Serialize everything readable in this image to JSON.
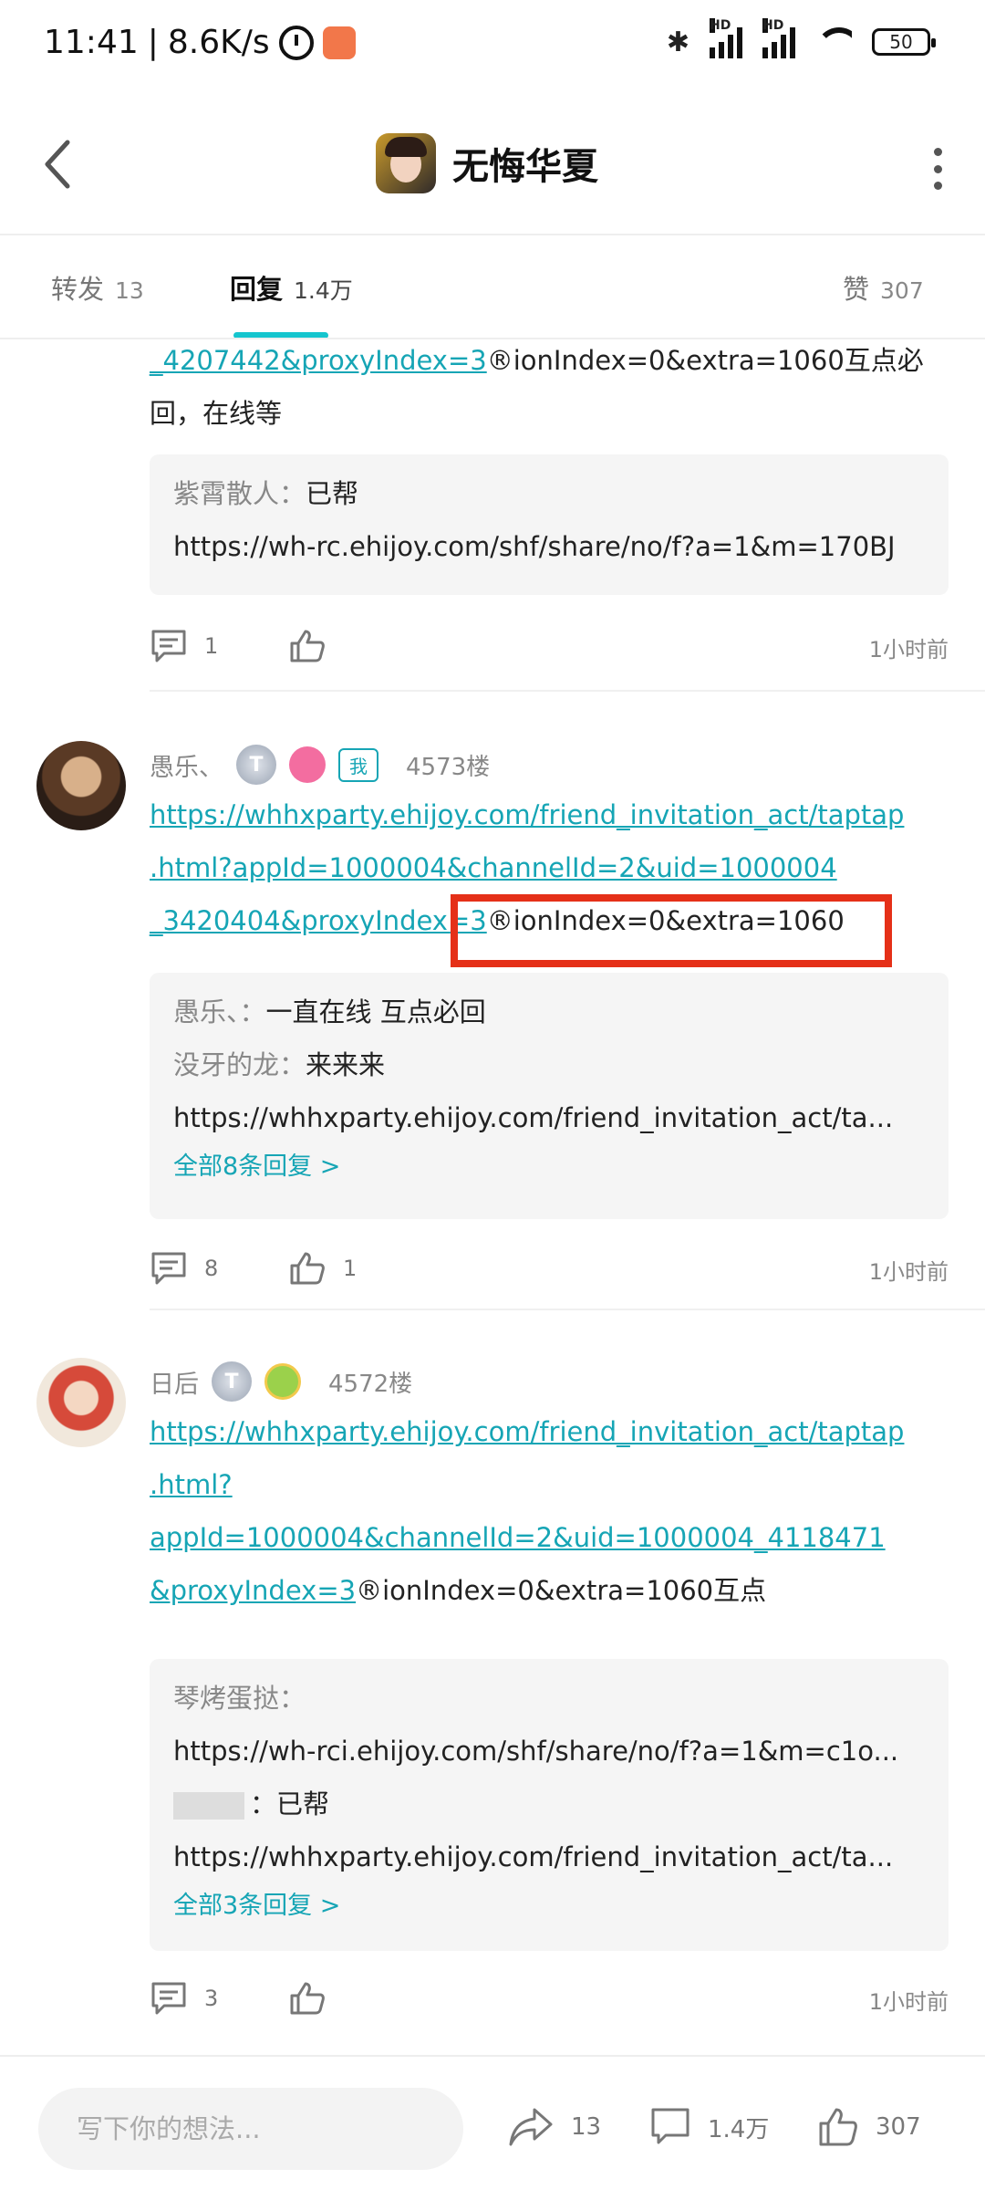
{
  "status_bar": {
    "time": "11:41",
    "speed": "8.6K/s",
    "battery": "50"
  },
  "header": {
    "title": "无悔华夏"
  },
  "tabs": [
    {
      "label": "转发",
      "count": "13"
    },
    {
      "label": "回复",
      "count": "1.4万"
    },
    {
      "label": "赞",
      "count": "307"
    }
  ],
  "posts": [
    {
      "partial_link": "_4207442&proxyIndex=3",
      "partial_text_tail": "®ionIndex=0&extra=1060互点必",
      "partial_text_line2": "回，在线等",
      "replies": [
        {
          "name": "紫霄散人：",
          "text": "已帮"
        },
        {
          "name": "",
          "text": "https://wh-rc.ehijoy.com/shf/share/no/f?a=1&m=170BJ"
        }
      ],
      "comment_count": "1",
      "like_count": "",
      "time": "1小时前"
    },
    {
      "username": "愚乐、",
      "me_tag": "我",
      "floor": "4573楼",
      "link_line1": "https://whhxparty.ehijoy.com/friend_invitation_act/taptap",
      "link_line2": ".html?appId=1000004&channelId=2&uid=1000004",
      "link_line3": "_3420404&proxyIndex=3",
      "text_tail": "®ionIndex=0&extra=1060",
      "replies": [
        {
          "name": "愚乐、：",
          "text": "一直在线 互点必回"
        },
        {
          "name": "没牙的龙：",
          "text": "来来来"
        },
        {
          "name": "",
          "text": "https://whhxparty.ehijoy.com/friend_invitation_act/ta..."
        }
      ],
      "all_replies": "全部8条回复 >",
      "comment_count": "8",
      "like_count": "1",
      "time": "1小时前"
    },
    {
      "username": "日后",
      "floor": "4572楼",
      "link_line1": "https://whhxparty.ehijoy.com/friend_invitation_act/taptap",
      "link_line2": ".html?appId=1000004&channelId=2&uid=1000004_4118471",
      "link_line3": "&proxyIndex=3",
      "text_tail": "®ionIndex=0&extra=1060互点",
      "replies": [
        {
          "name": "琴烤蛋挞：",
          "text": ""
        },
        {
          "name": "",
          "text": "https://wh-rci.ehijoy.com/shf/share/no/f?a=1&m=c1o..."
        },
        {
          "name": "",
          "text": "：已帮"
        },
        {
          "name": "",
          "text": "https://whhxparty.ehijoy.com/friend_invitation_act/ta..."
        }
      ],
      "all_replies": "全部3条回复 >",
      "comment_count": "3",
      "like_count": "",
      "time": "1小时前"
    }
  ],
  "bottom_bar": {
    "placeholder": "写下你的想法...",
    "share_count": "13",
    "comment_count": "1.4万",
    "like_count": "307"
  },
  "colors": {
    "accent": "#16a5b5",
    "highlight_box": "#e53018"
  }
}
